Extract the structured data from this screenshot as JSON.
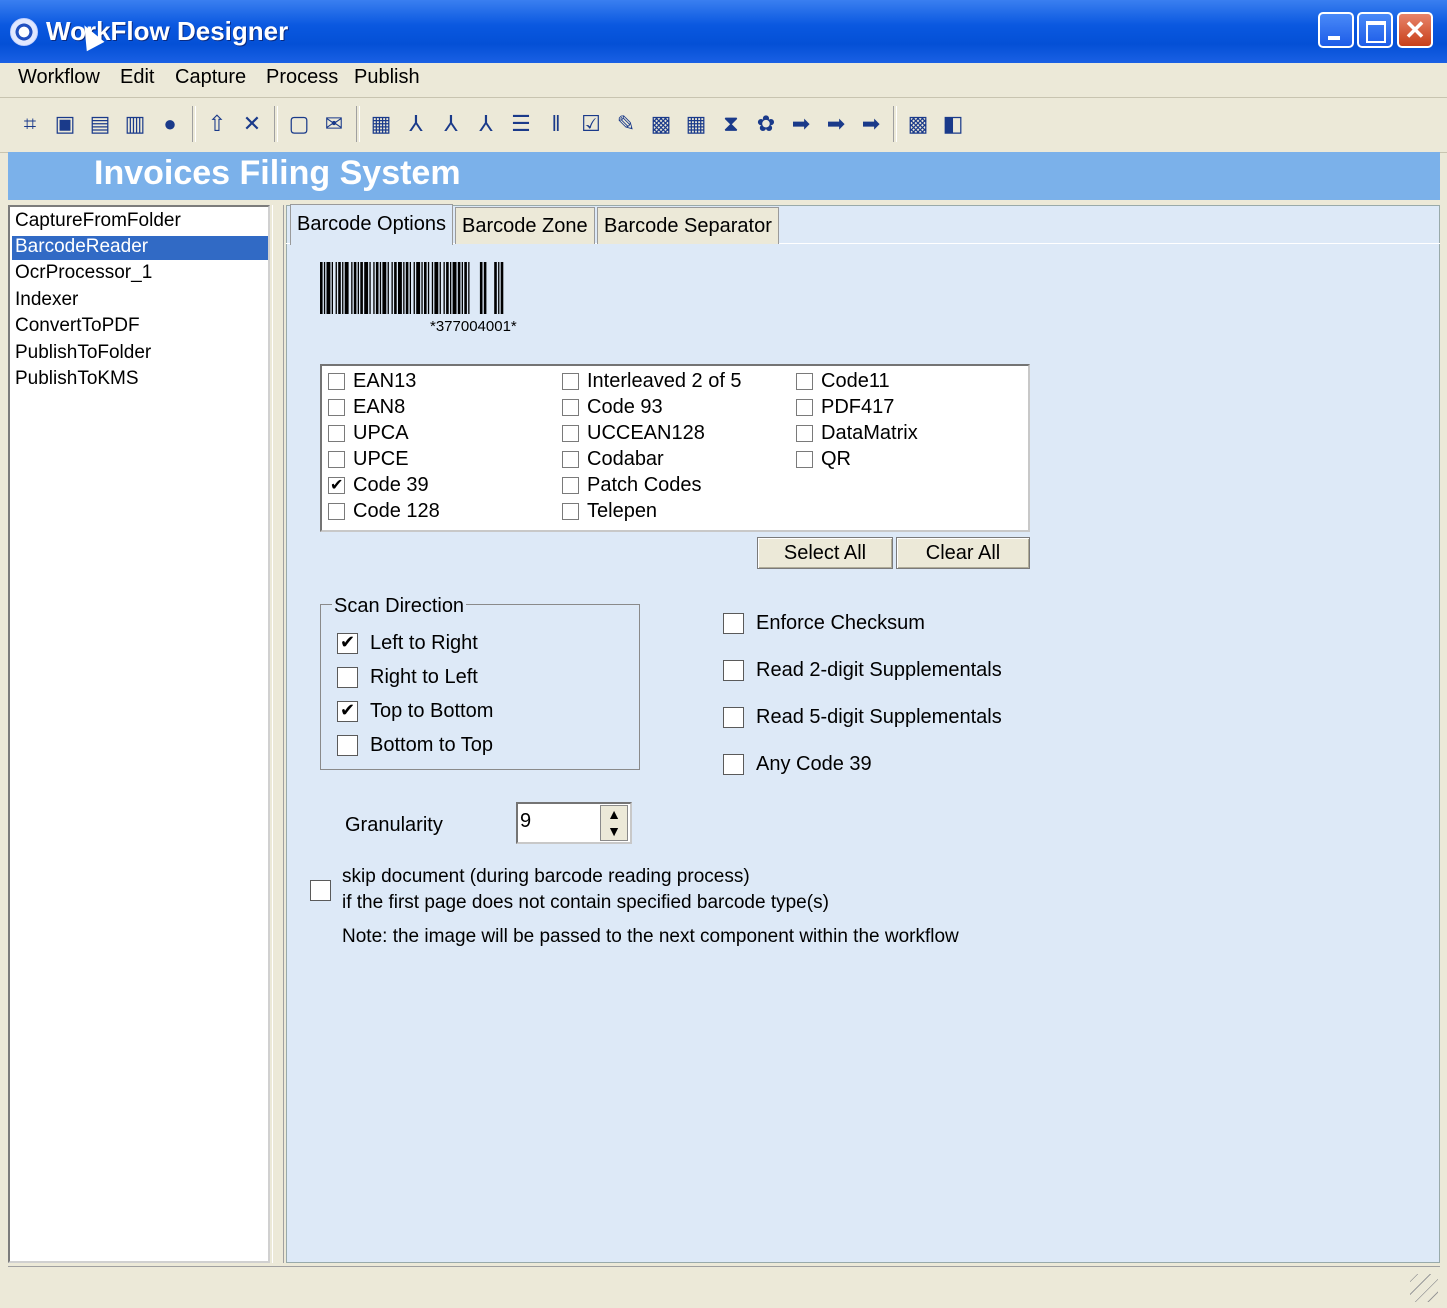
{
  "window": {
    "title": "WorkFlow Designer",
    "close_glyph": "✕"
  },
  "menu": [
    "Workflow",
    "Edit",
    "Capture",
    "Process",
    "Publish"
  ],
  "toolbar_icons": [
    "new-workflow-icon",
    "open-icon",
    "save-icon",
    "save-as-icon",
    "lock-icon",
    "up-arrow-icon",
    "delete-icon",
    "capture-folder-icon",
    "capture-email-icon",
    "scan-icon",
    "pdf-icon",
    "tiff-icon",
    "meta-icon",
    "ocr-icon",
    "barcode-icon",
    "indexer-icon",
    "validate-icon",
    "image-processing-icon",
    "form-icon",
    "sort-icon",
    "cleanup-icon",
    "publish-icon",
    "publish-folder-icon",
    "publish-kms-icon",
    "export-icon",
    "preview-icon"
  ],
  "header": {
    "title": "Invoices Filing System"
  },
  "components": {
    "items": [
      "CaptureFromFolder",
      "BarcodeReader",
      "OcrProcessor_1",
      "Indexer",
      "ConvertToPDF",
      "PublishToFolder",
      "PublishToKMS"
    ],
    "selected_index": 1
  },
  "tabs": {
    "items": [
      "Barcode Options",
      "Barcode Zone",
      "Barcode Separator"
    ],
    "active": "Barcode Options"
  },
  "barcode_sample": {
    "text": "*377004001*"
  },
  "barcode_types": {
    "col1": [
      {
        "label": "EAN13",
        "checked": false
      },
      {
        "label": "EAN8",
        "checked": false
      },
      {
        "label": "UPCA",
        "checked": false
      },
      {
        "label": "UPCE",
        "checked": false
      },
      {
        "label": "Code 39",
        "checked": true
      },
      {
        "label": "Code 128",
        "checked": false
      }
    ],
    "col2": [
      {
        "label": "Interleaved 2 of 5",
        "checked": false
      },
      {
        "label": "Code 93",
        "checked": false
      },
      {
        "label": "UCCEAN128",
        "checked": false
      },
      {
        "label": "Codabar",
        "checked": false
      },
      {
        "label": "Patch Codes",
        "checked": false
      },
      {
        "label": "Telepen",
        "checked": false
      }
    ],
    "col3": [
      {
        "label": "Code11",
        "checked": false
      },
      {
        "label": "PDF417",
        "checked": false
      },
      {
        "label": "DataMatrix",
        "checked": false
      },
      {
        "label": "QR",
        "checked": false
      }
    ]
  },
  "buttons": {
    "select_all": "Select All",
    "clear_all": "Clear All"
  },
  "scan_direction": {
    "legend": "Scan Direction",
    "options": [
      {
        "label": "Left to Right",
        "checked": true
      },
      {
        "label": "Right to Left",
        "checked": false
      },
      {
        "label": "Top to Bottom",
        "checked": true
      },
      {
        "label": "Bottom to Top",
        "checked": false
      }
    ]
  },
  "options": [
    {
      "label": "Enforce Checksum",
      "checked": false
    },
    {
      "label": "Read 2-digit Supplementals",
      "checked": false
    },
    {
      "label": "Read 5-digit Supplementals",
      "checked": false
    },
    {
      "label": "Any Code 39",
      "checked": false
    }
  ],
  "granularity": {
    "label": "Granularity",
    "value": "9"
  },
  "skip_document": {
    "line1": "skip document (during barcode reading process)",
    "line2": "if the first page does not contain specified barcode type(s)",
    "checked": false
  },
  "note": "Note: the image will be passed to the next component within the workflow"
}
